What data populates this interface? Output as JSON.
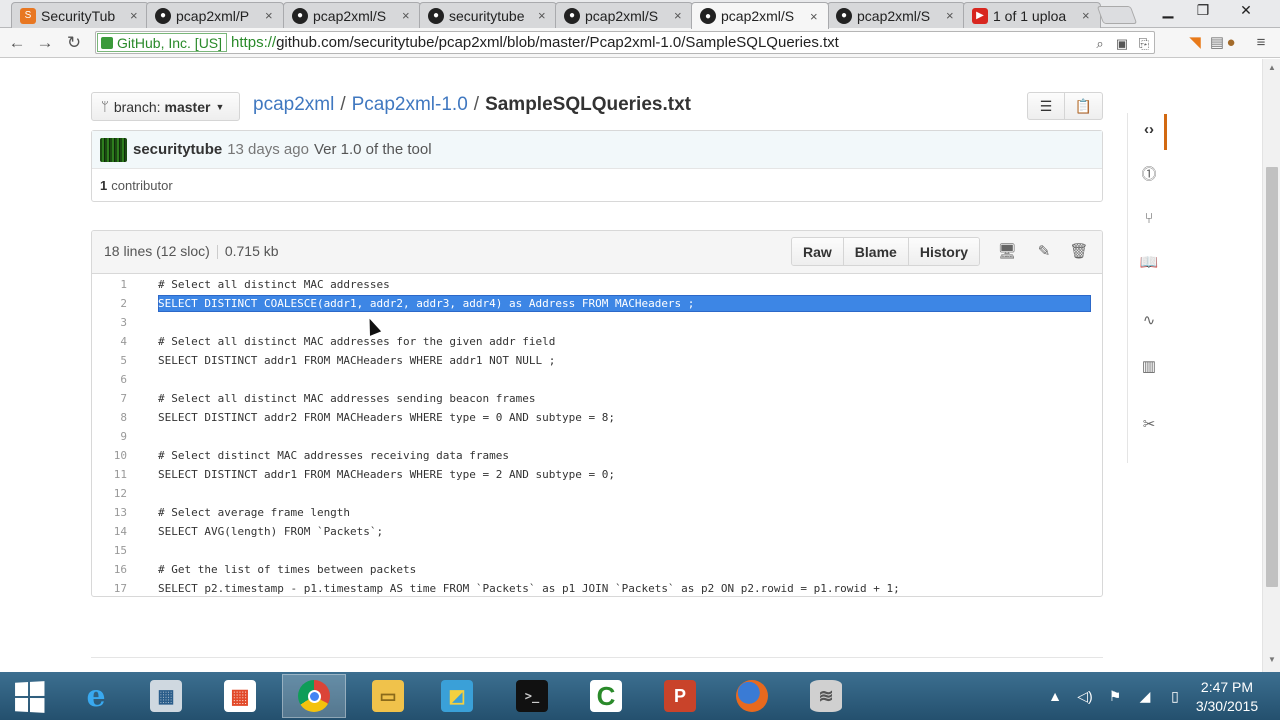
{
  "browser": {
    "tabs": [
      {
        "label": "SecurityTub",
        "favicon": "securitytube-icon",
        "active": false
      },
      {
        "label": "pcap2xml/P",
        "favicon": "github-icon",
        "active": false
      },
      {
        "label": "pcap2xml/S",
        "favicon": "github-icon",
        "active": false
      },
      {
        "label": "securitytube",
        "favicon": "github-icon",
        "active": false
      },
      {
        "label": "pcap2xml/S",
        "favicon": "github-icon",
        "active": false
      },
      {
        "label": "pcap2xml/S",
        "favicon": "github-icon",
        "active": true
      },
      {
        "label": "pcap2xml/S",
        "favicon": "github-icon",
        "active": false
      },
      {
        "label": "1 of 1 uploa",
        "favicon": "youtube-icon",
        "active": false
      }
    ],
    "ev_cert": "GitHub, Inc. [US]",
    "url_scheme": "https://",
    "url_rest": "github.com/securitytube/pcap2xml/blob/master/Pcap2xml-1.0/SampleSQLQueries.txt"
  },
  "repo": {
    "branch_label": "branch:",
    "branch_name": "master",
    "breadcrumb": {
      "repo": "pcap2xml",
      "folder": "Pcap2xml-1.0",
      "file": "SampleSQLQueries.txt",
      "sep": "/"
    },
    "commit": {
      "author": "securitytube",
      "age": "13 days ago",
      "message": "Ver 1.0 of the tool"
    },
    "contributors": {
      "count": "1",
      "label": "contributor"
    }
  },
  "file": {
    "lines_info": "18 lines (12 sloc)",
    "size": "0.715 kb",
    "buttons": {
      "raw": "Raw",
      "blame": "Blame",
      "history": "History"
    },
    "code_lines": [
      {
        "n": "1",
        "text": "# Select all distinct MAC addresses"
      },
      {
        "n": "2",
        "text": "SELECT DISTINCT COALESCE(addr1, addr2, addr3, addr4) as Address FROM MACHeaders ;"
      },
      {
        "n": "3",
        "text": ""
      },
      {
        "n": "4",
        "text": "# Select all distinct MAC addresses for the given addr field"
      },
      {
        "n": "5",
        "text": "SELECT DISTINCT addr1 FROM MACHeaders WHERE addr1 NOT NULL ;"
      },
      {
        "n": "6",
        "text": ""
      },
      {
        "n": "7",
        "text": "# Select all distinct MAC addresses sending beacon frames"
      },
      {
        "n": "8",
        "text": "SELECT DISTINCT addr2 FROM MACHeaders WHERE type = 0 AND subtype = 8;"
      },
      {
        "n": "9",
        "text": ""
      },
      {
        "n": "10",
        "text": "# Select distinct MAC addresses receiving data frames"
      },
      {
        "n": "11",
        "text": "SELECT DISTINCT addr1 FROM MACHeaders WHERE type = 2 AND subtype = 0;"
      },
      {
        "n": "12",
        "text": ""
      },
      {
        "n": "13",
        "text": "# Select average frame length"
      },
      {
        "n": "14",
        "text": "SELECT AVG(length) FROM `Packets`;"
      },
      {
        "n": "15",
        "text": ""
      },
      {
        "n": "16",
        "text": "# Get the list of times between packets"
      },
      {
        "n": "17",
        "text": "SELECT p2.timestamp - p1.timestamp AS time FROM `Packets` as p1 JOIN `Packets` as p2 ON p2.rowid = p1.rowid + 1;"
      }
    ],
    "selected_line": "2"
  },
  "taskbar": {
    "apps": [
      "internet-explorer-icon",
      "virtualbox-icon",
      "apps-icon",
      "chrome-icon",
      "file-explorer-icon",
      "network-manager-icon",
      "terminal-icon",
      "camtasia-icon",
      "powerpoint-icon",
      "firefox-icon",
      "database-icon"
    ],
    "time": "2:47 PM",
    "date": "3/30/2015"
  },
  "colors": {
    "link": "#4078c0",
    "selection": "#3d86e5",
    "taskbar": "#2f6283",
    "active_nav": "#d26911"
  }
}
